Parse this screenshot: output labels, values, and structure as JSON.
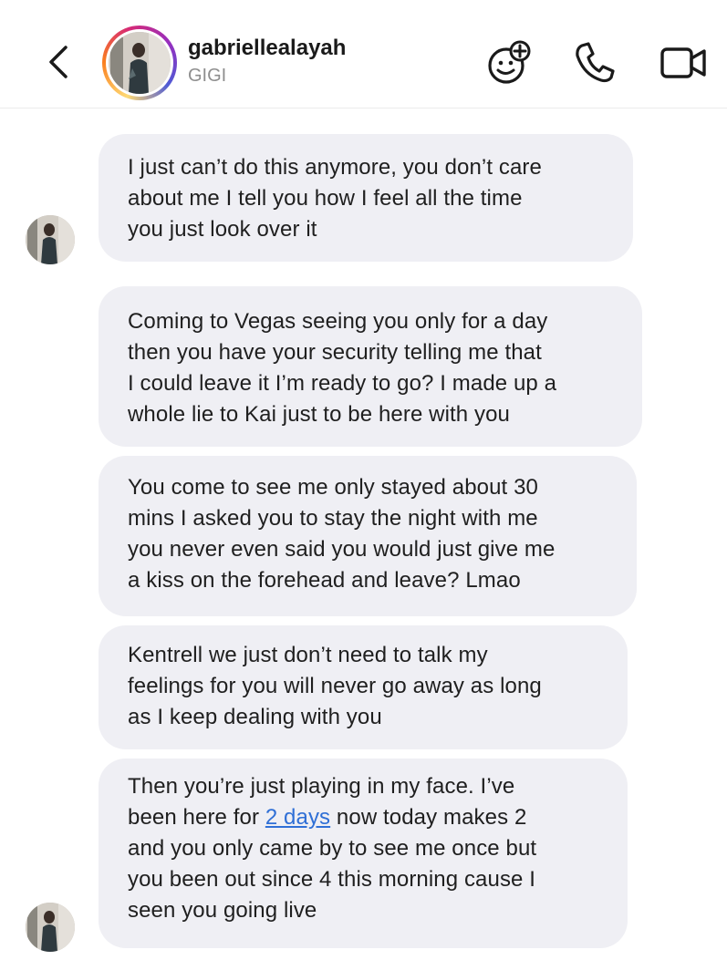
{
  "header": {
    "back_icon": "chevron-left-icon",
    "username": "gabriellealayah",
    "display_name": "GIGI",
    "actions": [
      {
        "name": "add-effect-icon",
        "label": "sticker-plus"
      },
      {
        "name": "phone-icon",
        "label": "audio call"
      },
      {
        "name": "video-icon",
        "label": "video call"
      }
    ]
  },
  "messages": [
    {
      "lines": [
        "I just can’t do this anymore, you don’t care",
        "about me I tell you how I feel all the time",
        "you just look over it"
      ],
      "show_avatar": true
    },
    {
      "lines": [
        "Coming to Vegas seeing you only for a day",
        "then you have your security telling me that",
        "I could leave it I’m ready to go? I made up a",
        "whole lie to Kai just to be here with you"
      ],
      "show_avatar": false
    },
    {
      "lines": [
        "You come to see me only stayed about 30",
        "mins I asked you to stay the night with me",
        "you never even said you would just give me",
        "a kiss on the forehead and leave? Lmao"
      ],
      "show_avatar": false
    },
    {
      "lines": [
        "Kentrell we just don’t need to talk my",
        "feelings for you will never go away as long",
        "as I keep dealing with you"
      ],
      "show_avatar": false
    },
    {
      "line1": "Then you’re just playing in my face. I’ve",
      "line2_before": "been here for ",
      "line2_link": "2 days",
      "line2_after": " now today makes 2",
      "lines_rest": [
        "and you only came by to see me once but",
        "you been out since 4 this morning cause I",
        "seen you going live"
      ],
      "show_avatar": true
    }
  ],
  "colors": {
    "bubble": "#efeff4",
    "link": "#2f6fd6",
    "secondary_text": "#8e8e8e"
  }
}
